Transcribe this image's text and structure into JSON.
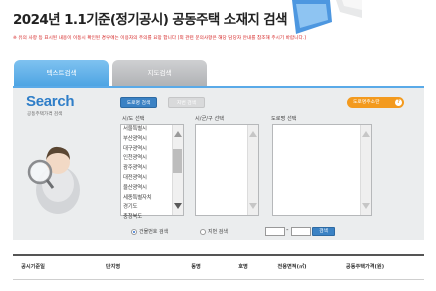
{
  "header": {
    "title": "2024년 1.1기준(정기공시) 공동주택 소재지 검색",
    "notice": "※ 유의 사항 등 표시된 내용이 이동시 확인된 경우에는 이용자의 주의를 요망 합니다 [외 관련 문의사항은 해당 담당자 안내를 참조해 주시기 바랍니다.]"
  },
  "tabs": [
    {
      "label": "텍스트검색",
      "active": true
    },
    {
      "label": "지도검색",
      "active": false
    }
  ],
  "search_panel": {
    "logo_title": "Search",
    "logo_subtitle": "공동주택가격 검색",
    "road_button": "도로명 검색",
    "lot_button": "지번 검색",
    "help_button": "도로명주소란",
    "help_icon": "?",
    "sido_label": "시/도 선택",
    "sigungu_label": "시/군/구 선택",
    "road_label": "도로명 선택",
    "sido_options": [
      "서울특별시",
      "부산광역시",
      "대구광역시",
      "인천광역시",
      "광주광역시",
      "대전광역시",
      "울산광역시",
      "세종특별자치",
      "경기도",
      "충청북도"
    ],
    "radio_apt_label": "건물번호 검색",
    "radio_lot_label": "지번 검색",
    "radio_apt_checked": true,
    "dash": "-",
    "search_button": "검색"
  },
  "results_table": {
    "columns": [
      "공시기준일",
      "단지명",
      "동명",
      "호명",
      "전용면적(㎡)",
      "공동주택가격(원)"
    ]
  },
  "colors": {
    "accent": "#2f7ec8",
    "tab_active": "#5aaae8",
    "help_orange": "#f39a1e",
    "notice_red": "#d42020"
  }
}
